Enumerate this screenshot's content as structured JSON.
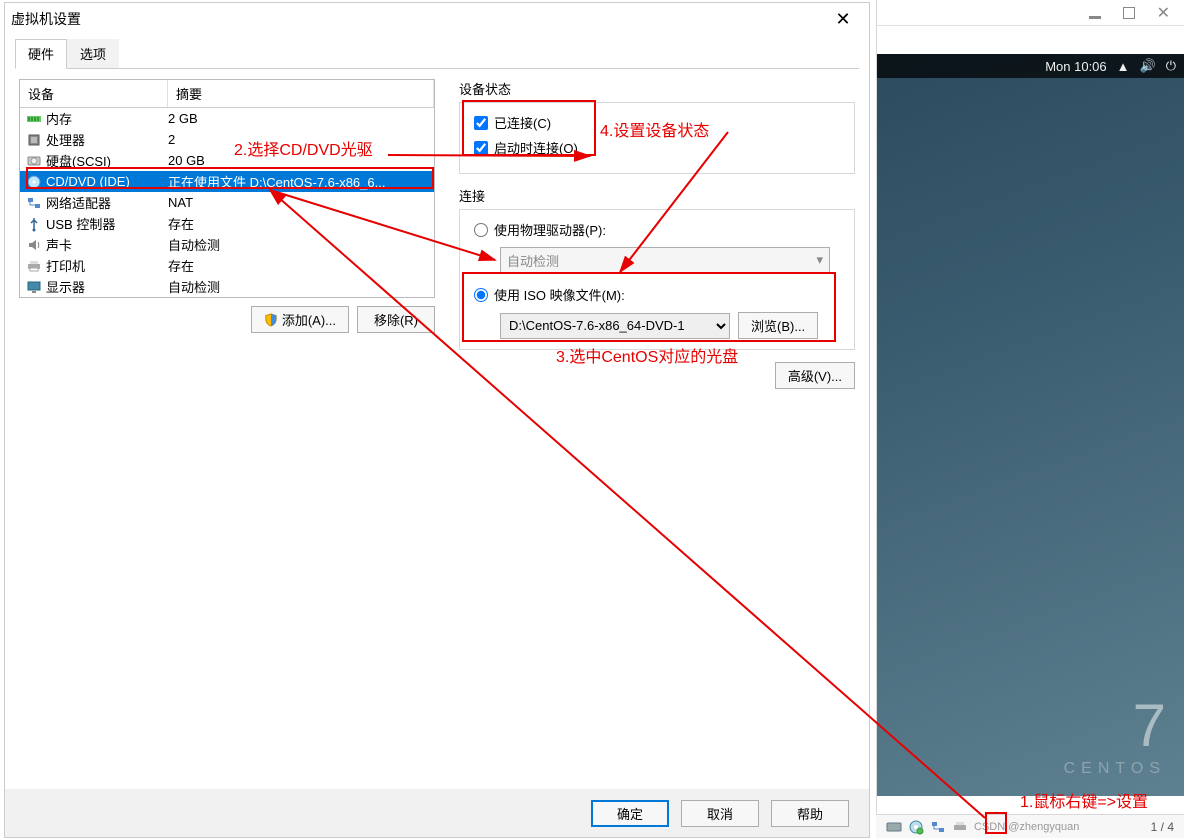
{
  "dialog": {
    "title": "虚拟机设置",
    "tabs": {
      "hardware": "硬件",
      "options": "选项"
    },
    "columns": {
      "device": "设备",
      "summary": "摘要"
    },
    "rows": [
      {
        "icon_name": "memory-icon",
        "name": "内存",
        "summary": "2 GB"
      },
      {
        "icon_name": "cpu-icon",
        "name": "处理器",
        "summary": "2"
      },
      {
        "icon_name": "disk-icon",
        "name": "硬盘(SCSI)",
        "summary": "20 GB"
      },
      {
        "icon_name": "cd-icon",
        "name": "CD/DVD (IDE)",
        "summary": "正在使用文件 D:\\CentOS-7.6-x86_6..."
      },
      {
        "icon_name": "nic-icon",
        "name": "网络适配器",
        "summary": "NAT"
      },
      {
        "icon_name": "usb-icon",
        "name": "USB 控制器",
        "summary": "存在"
      },
      {
        "icon_name": "sound-icon",
        "name": "声卡",
        "summary": "自动检测"
      },
      {
        "icon_name": "printer-icon",
        "name": "打印机",
        "summary": "存在"
      },
      {
        "icon_name": "display-icon",
        "name": "显示器",
        "summary": "自动检测"
      }
    ],
    "selected_index": 3,
    "buttons": {
      "add": "添加(A)...",
      "remove": "移除(R)"
    }
  },
  "panel": {
    "device_state": {
      "title": "设备状态",
      "connected": "已连接(C)",
      "connect_startup": "启动时连接(O)"
    },
    "connection": {
      "title": "连接",
      "use_physical": "使用物理驱动器(P):",
      "auto_detect": "自动检测",
      "use_iso": "使用 ISO 映像文件(M):",
      "iso_path": "D:\\CentOS-7.6-x86_64-DVD-1",
      "browse": "浏览(B)..."
    },
    "advanced": "高级(V)..."
  },
  "footer": {
    "ok": "确定",
    "cancel": "取消",
    "help": "帮助"
  },
  "guest": {
    "clock": "Mon 10:06",
    "centos_num": "7",
    "centos_word": "CENTOS",
    "pager": "1 / 4",
    "watermark": "CSDN @zhengyquan"
  },
  "ann": {
    "step1": "1.鼠标右键=>设置",
    "step2": "2.选择CD/DVD光驱",
    "step3": "3.选中CentOS对应的光盘",
    "step4": "4.设置设备状态"
  }
}
